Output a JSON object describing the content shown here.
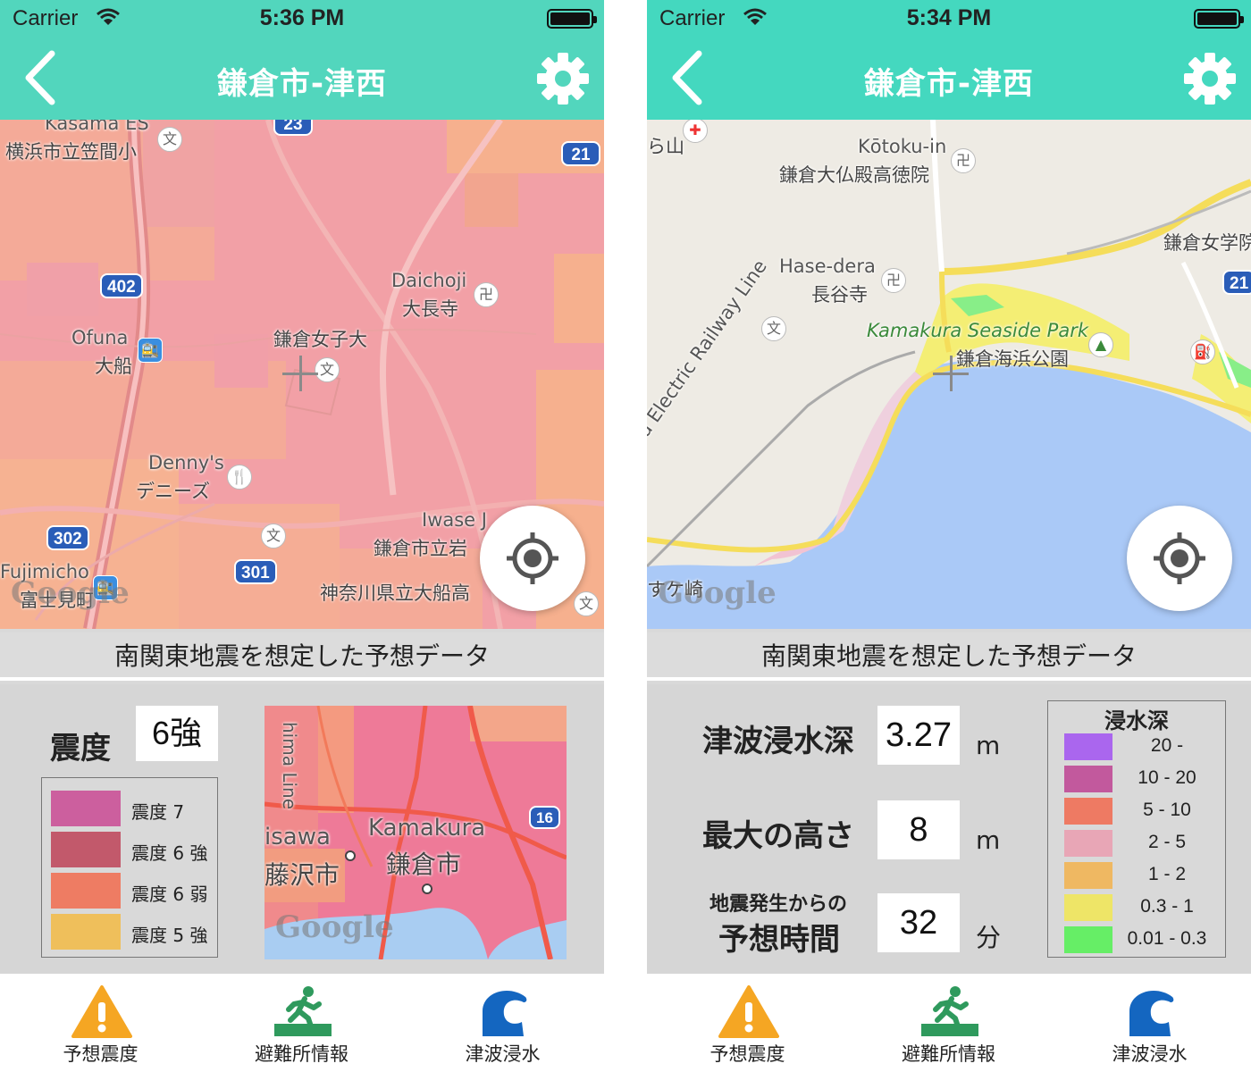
{
  "screens": [
    {
      "status": {
        "carrier": "Carrier",
        "time": "5:36 PM"
      },
      "nav": {
        "title": "鎌倉市-津西"
      },
      "map_labels": {
        "kasama_en": "Kasama ES",
        "kasama_ja": "横浜市立笠間小",
        "daichoji_en": "Daichoji",
        "daichoji_ja": "大長寺",
        "ofuna_en": "Ofuna",
        "ofuna_ja": "大船",
        "joshi_dai": "鎌倉女子大",
        "dennys_en": "Denny's",
        "dennys_ja": "デニーズ",
        "iwase_en": "Iwase J",
        "iwase_ja": "鎌倉市立岩",
        "fujimicho_en": "Fujimicho",
        "fujimicho_ja": "富士見町",
        "ofuna_hs": "神奈川県立大船高",
        "google": "Google"
      },
      "routes": [
        "23",
        "21",
        "402",
        "302",
        "301"
      ],
      "caption": "南関東地震を想定した予想データ",
      "intensity": {
        "label": "震度",
        "value": "6強"
      },
      "legend": [
        {
          "label": "震度 7",
          "color": "#cc5f9e"
        },
        {
          "label": "震度 6 強",
          "color": "#c2596b"
        },
        {
          "label": "震度 6 弱",
          "color": "#ee7c63"
        },
        {
          "label": "震度 5 強",
          "color": "#efbf5b"
        }
      ],
      "minimap_labels": {
        "line": "hima Line",
        "fujisawa_en": "isawa",
        "fujisawa_ja": "藤沢市",
        "kamakura_en": "Kamakura",
        "kamakura_ja": "鎌倉市",
        "route": "16",
        "google": "Google"
      },
      "tabs": [
        {
          "label": "予想震度",
          "icon": "warning-icon"
        },
        {
          "label": "避難所情報",
          "icon": "evacuation-runner-icon"
        },
        {
          "label": "津波浸水",
          "icon": "tsunami-wave-icon"
        }
      ]
    },
    {
      "status": {
        "carrier": "Carrier",
        "time": "5:34 PM"
      },
      "nav": {
        "title": "鎌倉市-津西"
      },
      "map_labels": {
        "yama": "ら山",
        "kotoku_en": "Kōtoku-in",
        "kotoku_ja": "鎌倉大仏殿高徳院",
        "hasedera_en": "Hase-dera",
        "hasedera_ja": "長谷寺",
        "girls_school": "鎌倉女学院",
        "railway": "ma Electric Railway Line",
        "seaside_en": "Kamakura Seaside Park",
        "seaside_ja": "鎌倉海浜公園",
        "zaki": "すケ崎",
        "google": "Google"
      },
      "routes": [
        "21"
      ],
      "caption": "南関東地震を想定した予想データ",
      "tsunami": {
        "depth_label": "津波浸水深",
        "depth_value": "3.27",
        "depth_unit": "m",
        "height_label": "最大の高さ",
        "height_value": "8",
        "height_unit": "m",
        "time_label_top": "地震発生からの",
        "time_label_bottom": "予想時間",
        "time_value": "32",
        "time_unit": "分"
      },
      "depth_legend": {
        "title": "浸水深",
        "items": [
          {
            "label": "20 -",
            "color": "#aa66ee"
          },
          {
            "label": "10 - 20",
            "color": "#c2599d"
          },
          {
            "label": "5 - 10",
            "color": "#ee7a63"
          },
          {
            "label": "2 - 5",
            "color": "#e8a6b6"
          },
          {
            "label": "1 - 2",
            "color": "#efb862"
          },
          {
            "label": "0.3 - 1",
            "color": "#eee567"
          },
          {
            "label": "0.01 - 0.3",
            "color": "#66ee66"
          }
        ]
      },
      "tabs": [
        {
          "label": "予想震度",
          "icon": "warning-icon"
        },
        {
          "label": "避難所情報",
          "icon": "evacuation-runner-icon"
        },
        {
          "label": "津波浸水",
          "icon": "tsunami-wave-icon"
        }
      ]
    }
  ]
}
